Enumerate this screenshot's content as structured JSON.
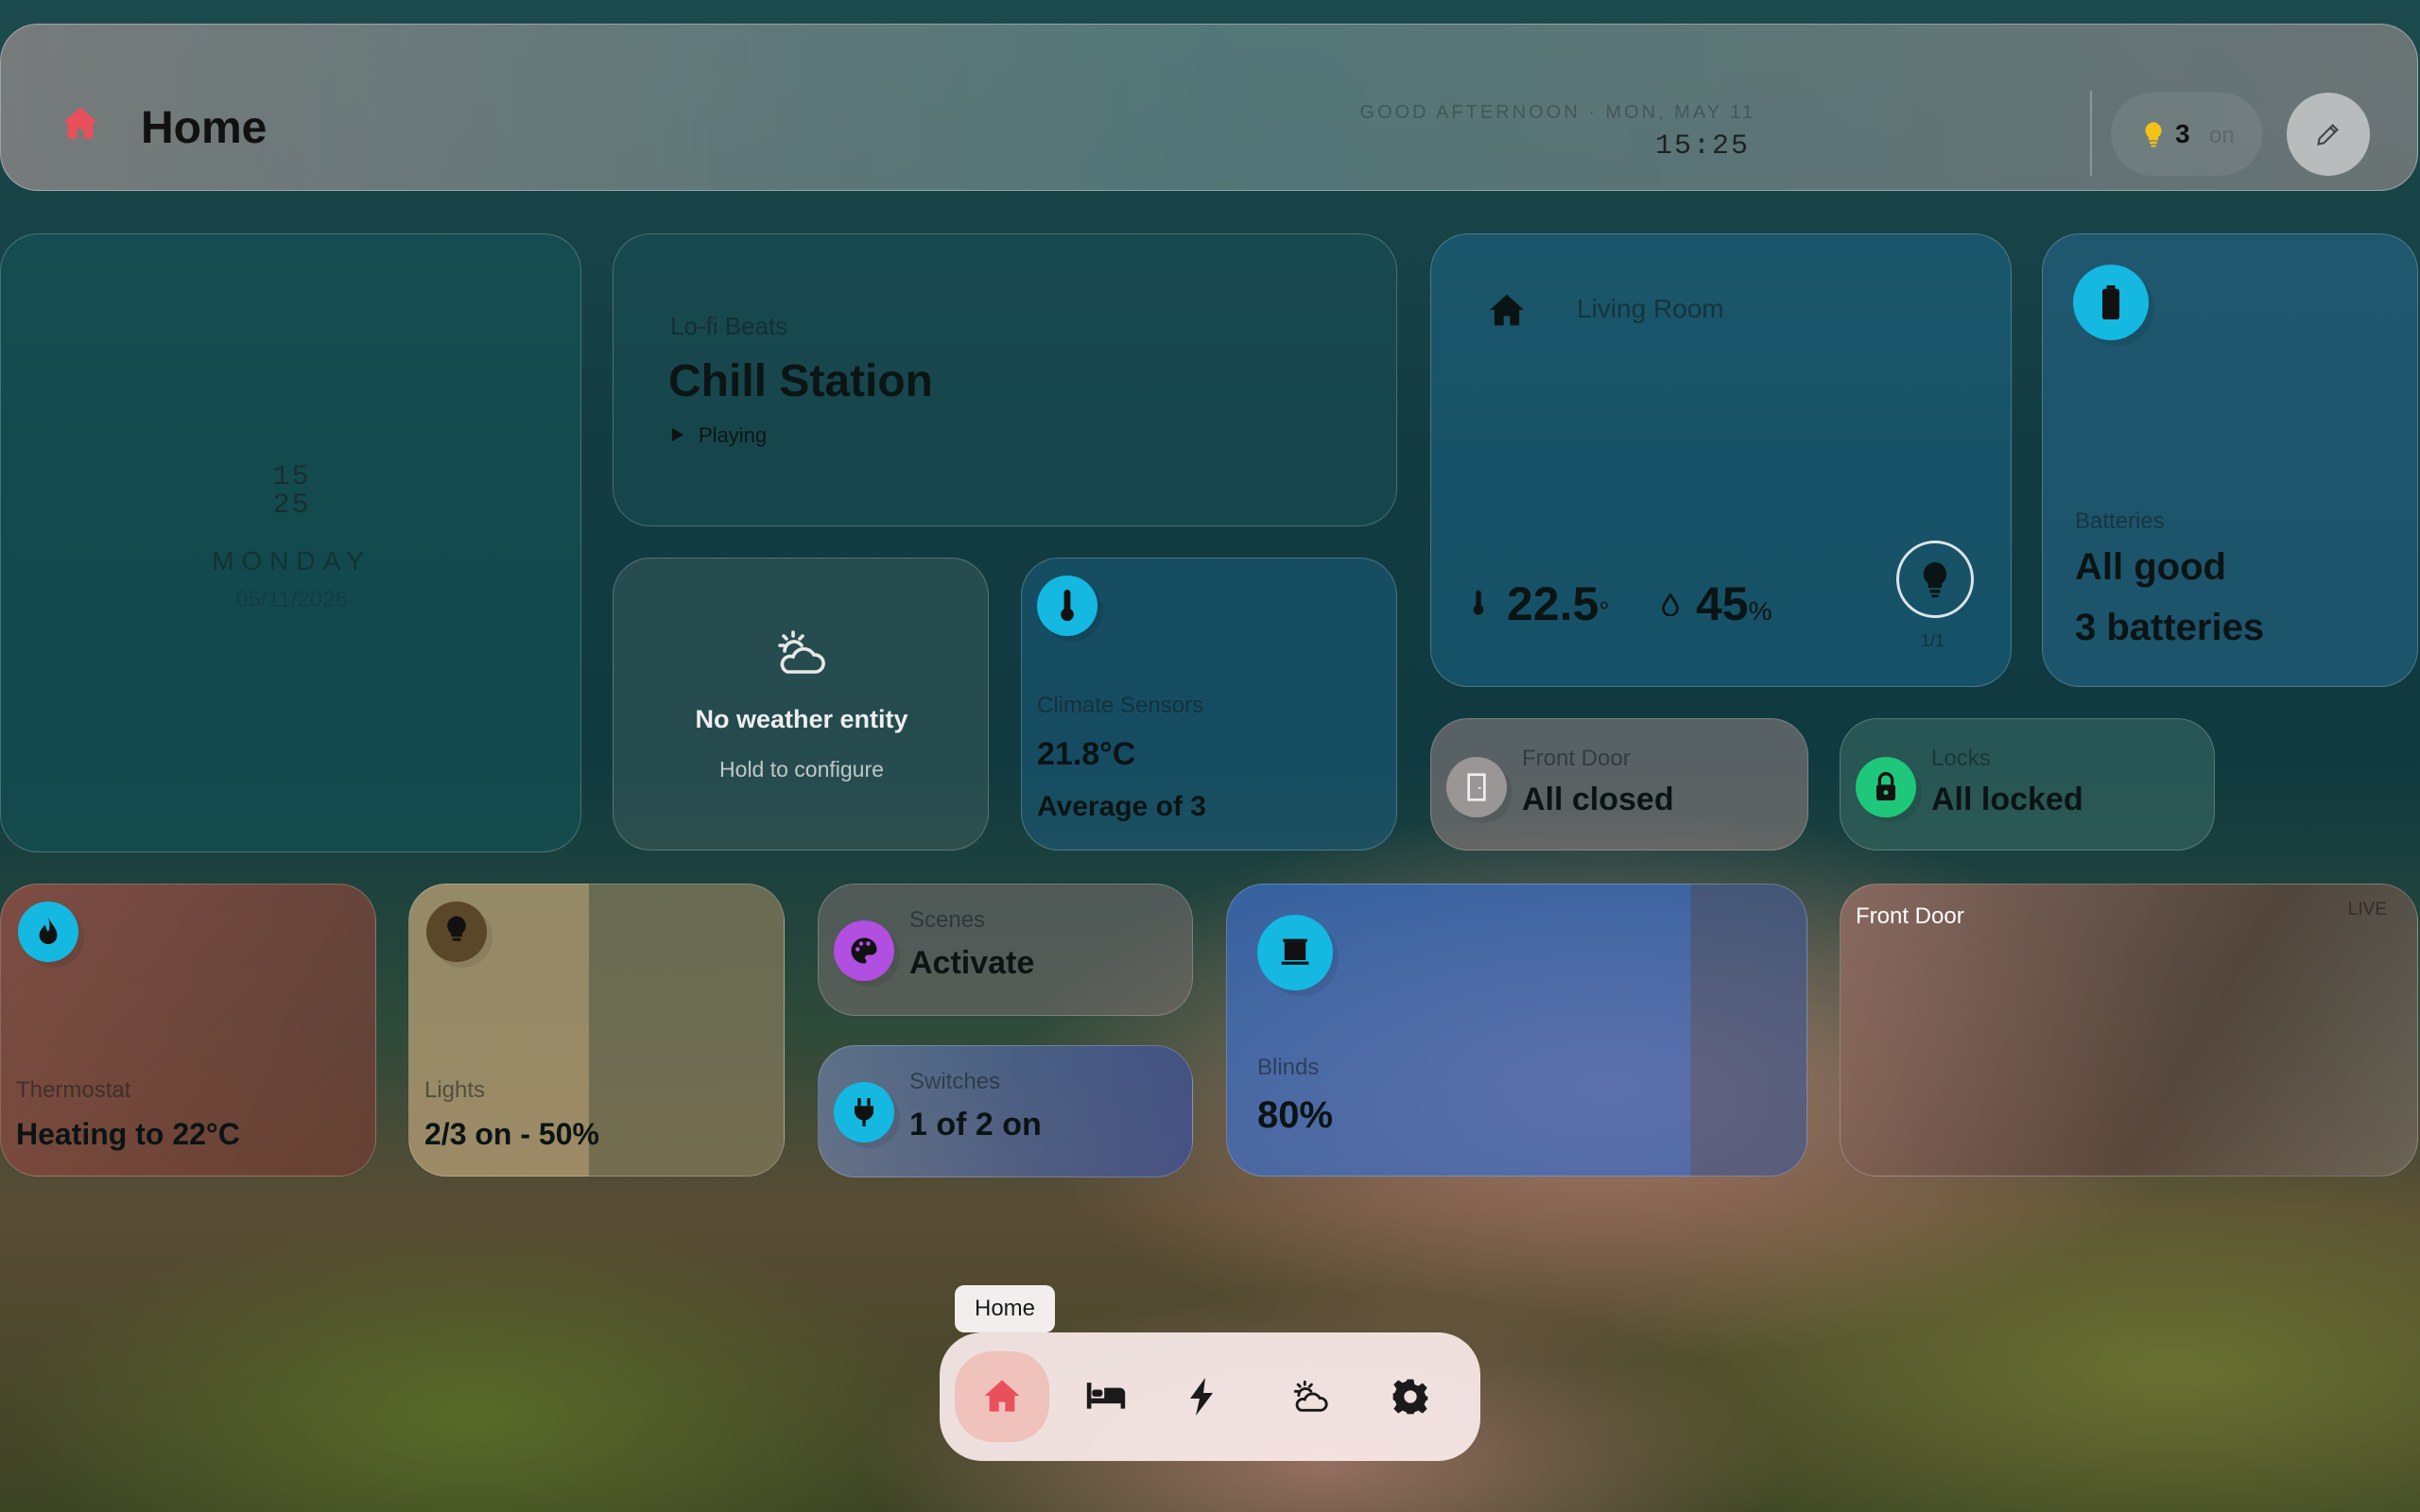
{
  "header": {
    "title": "Home",
    "greeting": "GOOD AFTERNOON · MON, MAY 11",
    "time": "15:25",
    "lights_count": "3",
    "lights_suffix": "on",
    "edit_icon": "pencil-icon"
  },
  "clock_card": {
    "hour": "15",
    "minute": "25",
    "weekday": "MONDAY",
    "date": "05/11/2026"
  },
  "media": {
    "source": "Lo-fi Beats",
    "title": "Chill Station",
    "state": "Playing"
  },
  "weather": {
    "title": "No weather entity",
    "subtitle": "Hold to configure"
  },
  "climate": {
    "label": "Climate Sensors",
    "value": "21.8°C",
    "detail": "Average of 3"
  },
  "room": {
    "name": "Living Room",
    "temperature": "22.5",
    "temp_unit": "°",
    "humidity": "45",
    "hum_unit": "%",
    "lights_on": "1/1"
  },
  "batteries": {
    "label": "Batteries",
    "status": "All good",
    "count": "3 batteries"
  },
  "front_door": {
    "label": "Front Door",
    "value": "All closed"
  },
  "locks": {
    "label": "Locks",
    "value": "All locked"
  },
  "thermostat": {
    "label": "Thermostat",
    "value": "Heating to 22°C"
  },
  "lights": {
    "label": "Lights",
    "value": "2/3 on - 50%"
  },
  "scenes": {
    "label": "Scenes",
    "value": "Activate"
  },
  "switches": {
    "label": "Switches",
    "value": "1 of 2 on"
  },
  "blinds": {
    "label": "Blinds",
    "value": "80%"
  },
  "camera": {
    "title": "Front Door",
    "badge": "LIVE"
  },
  "nav": {
    "tooltip": "Home",
    "items": [
      "home-icon",
      "bed-icon",
      "lightning-icon",
      "partly-cloudy-icon",
      "gear-icon"
    ]
  },
  "colors": {
    "accent_red": "#e8505b",
    "cyan": "#14b8e0",
    "purple": "#b04fe0",
    "green": "#1fc77a",
    "bulb_yellow": "#f3c318"
  }
}
